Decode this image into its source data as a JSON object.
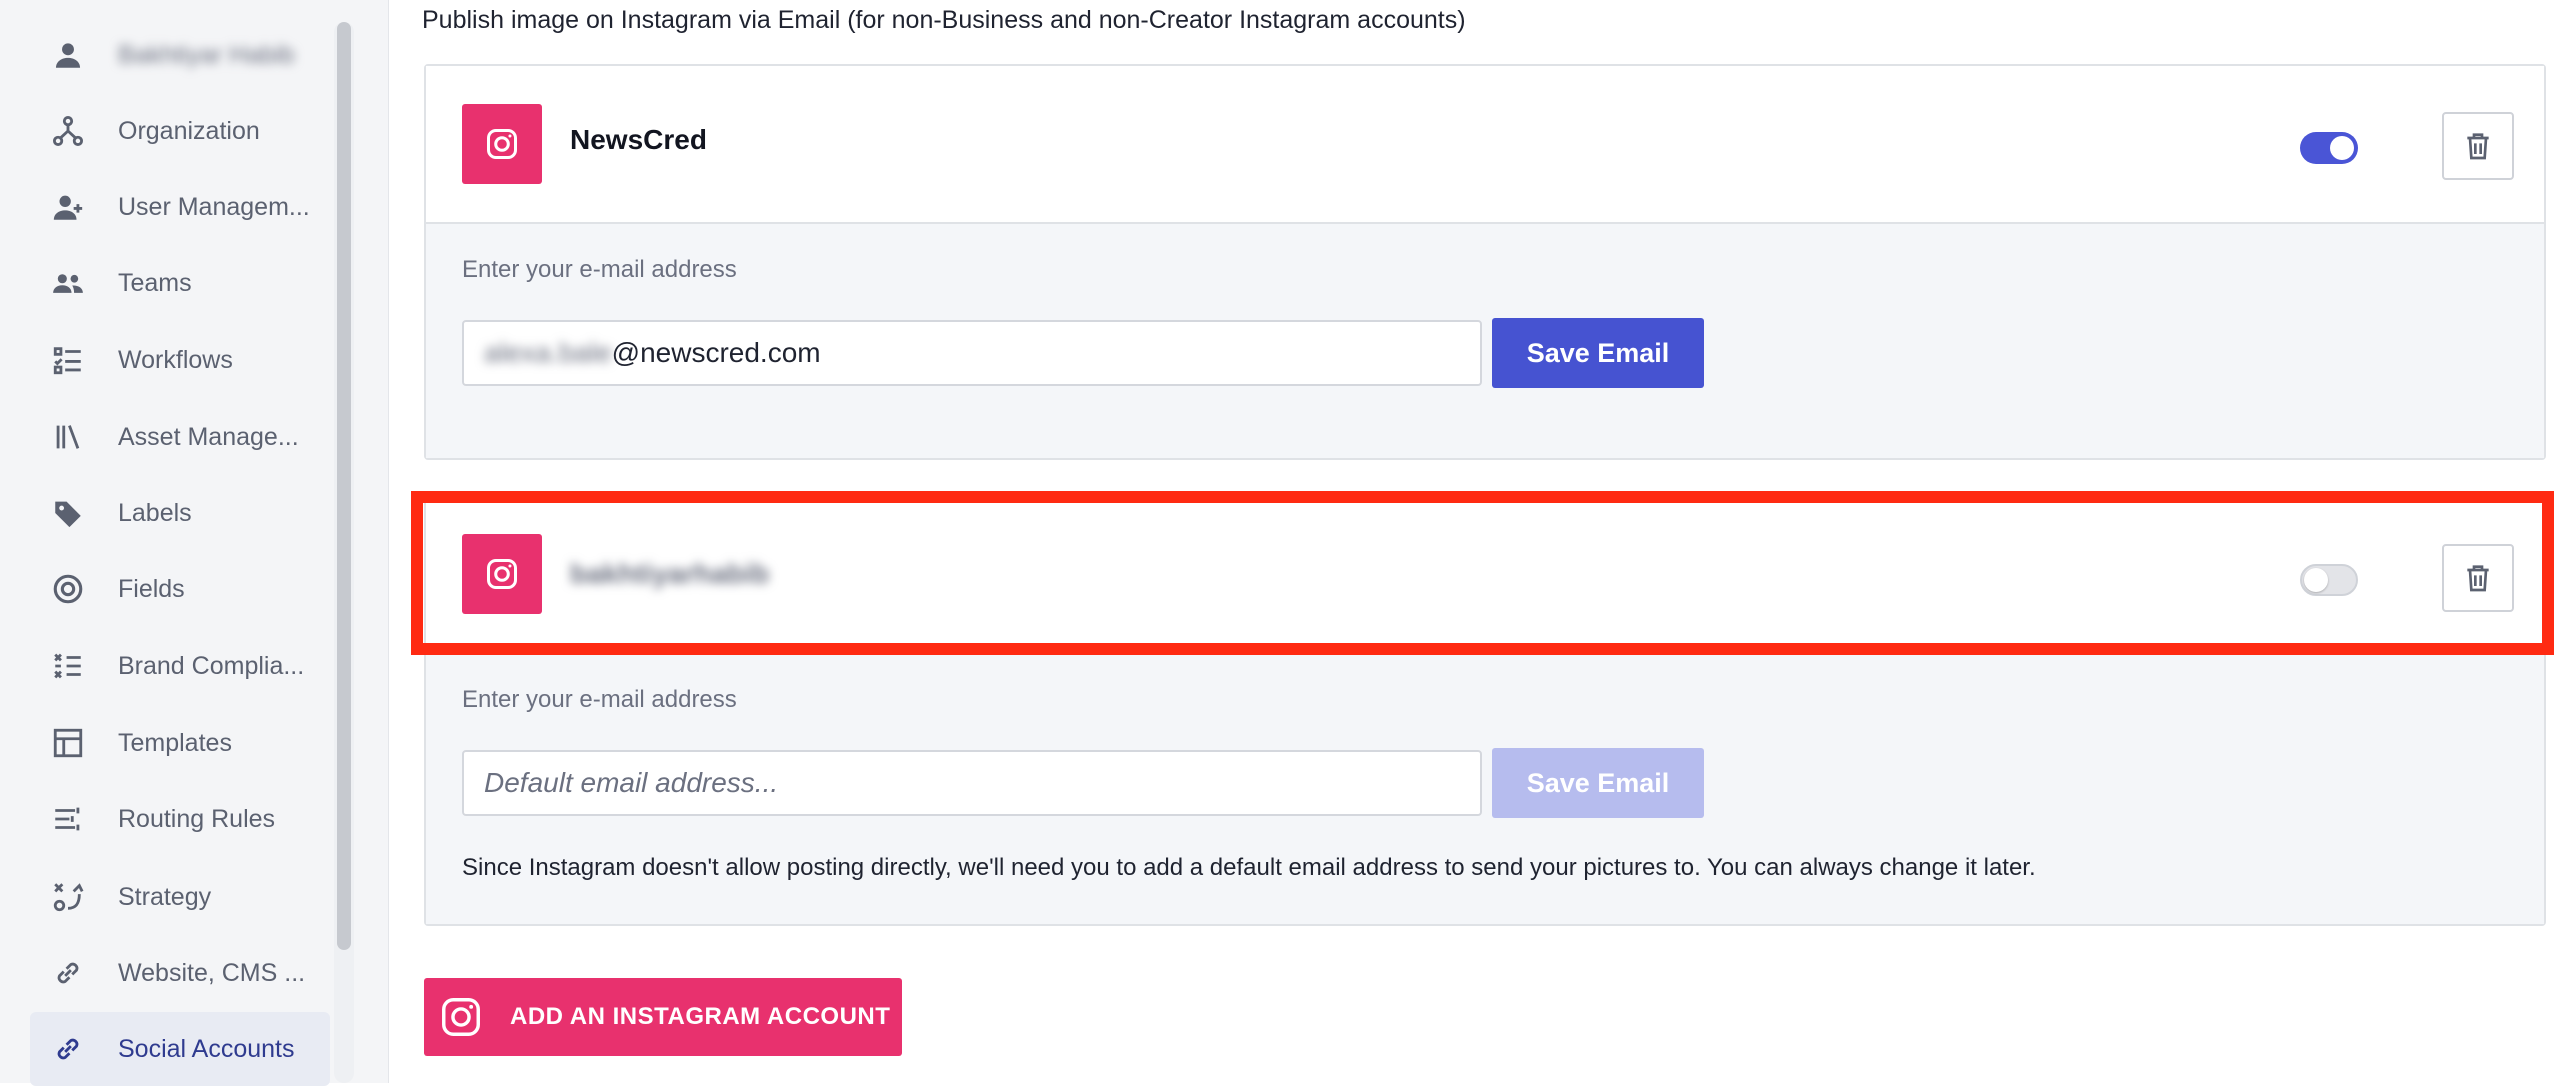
{
  "sidebar": {
    "items": [
      {
        "label": "Bakhtiyar Habib",
        "icon": "user-icon",
        "blurred": true
      },
      {
        "label": "Organization",
        "icon": "organization-icon"
      },
      {
        "label": "User Managem...",
        "icon": "user-add-icon"
      },
      {
        "label": "Teams",
        "icon": "teams-icon"
      },
      {
        "label": "Workflows",
        "icon": "workflow-icon"
      },
      {
        "label": "Asset Manage...",
        "icon": "library-icon"
      },
      {
        "label": "Labels",
        "icon": "tag-icon"
      },
      {
        "label": "Fields",
        "icon": "target-icon"
      },
      {
        "label": "Brand Complia...",
        "icon": "checklist-icon"
      },
      {
        "label": "Templates",
        "icon": "template-icon"
      },
      {
        "label": "Routing Rules",
        "icon": "routing-icon"
      },
      {
        "label": "Strategy",
        "icon": "strategy-icon"
      },
      {
        "label": "Website, CMS ...",
        "icon": "link-icon"
      },
      {
        "label": "Social Accounts",
        "icon": "link-icon",
        "active": true
      }
    ]
  },
  "main": {
    "intro": "Publish image on Instagram via Email (for non-Business and non-Creator Instagram accounts)",
    "accounts": [
      {
        "name": "NewsCred",
        "enabled": true,
        "email_label": "Enter your e-mail address",
        "email_prefix": "alexa.bale",
        "email_suffix": "@newscred.com",
        "save_label": "Save Email"
      },
      {
        "name": "bakhtiyarhabib",
        "enabled": false,
        "email_label": "Enter your e-mail address",
        "email_placeholder": "Default email address...",
        "save_label": "Save Email",
        "note": "Since Instagram doesn't allow posting directly, we'll need you to add a default email address to send your pictures to. You can always change it later."
      }
    ],
    "add_button_label": "ADD AN INSTAGRAM ACCOUNT"
  },
  "colors": {
    "instagram_pink": "#e8316e",
    "primary": "#4653d1",
    "highlight": "#ff2a12"
  }
}
